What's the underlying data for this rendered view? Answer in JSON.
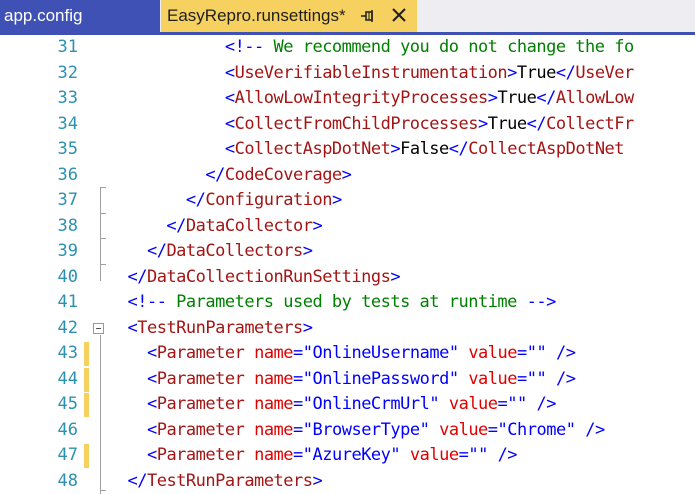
{
  "tabs": [
    {
      "label": "app.config",
      "active": false
    },
    {
      "label": "EasyRepro.runsettings*",
      "active": true,
      "pin_icon": "pin-icon",
      "close_icon": "close-icon"
    }
  ],
  "colors": {
    "tab_inactive_bg": "#3f51b5",
    "tab_active_bg": "#f7d15f",
    "line_number": "#2b91af",
    "xml_delimiter": "#0000ff",
    "xml_name": "#a31515",
    "xml_attribute": "#e00000",
    "comment": "#008000",
    "change_marker": "#f7d15f"
  },
  "editor": {
    "lines": [
      {
        "num": "31",
        "changed": false,
        "tokens": [
          [
            "c",
            "            "
          ],
          [
            "blue",
            "<!--"
          ],
          [
            "green",
            " We recommend you do not change the fo"
          ]
        ]
      },
      {
        "num": "32",
        "changed": false,
        "tokens": [
          [
            "c",
            "            "
          ],
          [
            "blue",
            "<"
          ],
          [
            "mar",
            "UseVerifiableInstrumentation"
          ],
          [
            "blue",
            ">"
          ],
          [
            "black",
            "True"
          ],
          [
            "blue",
            "</"
          ],
          [
            "mar",
            "UseVer"
          ]
        ]
      },
      {
        "num": "33",
        "changed": false,
        "tokens": [
          [
            "c",
            "            "
          ],
          [
            "blue",
            "<"
          ],
          [
            "mar",
            "AllowLowIntegrityProcesses"
          ],
          [
            "blue",
            ">"
          ],
          [
            "black",
            "True"
          ],
          [
            "blue",
            "</"
          ],
          [
            "mar",
            "AllowLow"
          ]
        ]
      },
      {
        "num": "34",
        "changed": false,
        "tokens": [
          [
            "c",
            "            "
          ],
          [
            "blue",
            "<"
          ],
          [
            "mar",
            "CollectFromChildProcesses"
          ],
          [
            "blue",
            ">"
          ],
          [
            "black",
            "True"
          ],
          [
            "blue",
            "</"
          ],
          [
            "mar",
            "CollectFr"
          ]
        ]
      },
      {
        "num": "35",
        "changed": false,
        "tokens": [
          [
            "c",
            "            "
          ],
          [
            "blue",
            "<"
          ],
          [
            "mar",
            "CollectAspDotNet"
          ],
          [
            "blue",
            ">"
          ],
          [
            "black",
            "False"
          ],
          [
            "blue",
            "</"
          ],
          [
            "mar",
            "CollectAspDotNet"
          ]
        ]
      },
      {
        "num": "36",
        "changed": false,
        "tokens": [
          [
            "c",
            "          "
          ],
          [
            "blue",
            "</"
          ],
          [
            "mar",
            "CodeCoverage"
          ],
          [
            "blue",
            ">"
          ]
        ]
      },
      {
        "num": "37",
        "changed": false,
        "tokens": [
          [
            "c",
            "        "
          ],
          [
            "blue",
            "</"
          ],
          [
            "mar",
            "Configuration"
          ],
          [
            "blue",
            ">"
          ]
        ]
      },
      {
        "num": "38",
        "changed": false,
        "tokens": [
          [
            "c",
            "      "
          ],
          [
            "blue",
            "</"
          ],
          [
            "mar",
            "DataCollector"
          ],
          [
            "blue",
            ">"
          ]
        ]
      },
      {
        "num": "39",
        "changed": false,
        "tokens": [
          [
            "c",
            "    "
          ],
          [
            "blue",
            "</"
          ],
          [
            "mar",
            "DataCollectors"
          ],
          [
            "blue",
            ">"
          ]
        ]
      },
      {
        "num": "40",
        "changed": false,
        "tokens": [
          [
            "c",
            "  "
          ],
          [
            "blue",
            "</"
          ],
          [
            "mar",
            "DataCollectionRunSettings"
          ],
          [
            "blue",
            ">"
          ]
        ]
      },
      {
        "num": "41",
        "changed": false,
        "tokens": [
          [
            "c",
            "  "
          ],
          [
            "blue",
            "<!--"
          ],
          [
            "green",
            " Parameters used by tests at runtime "
          ],
          [
            "blue",
            "-->"
          ]
        ]
      },
      {
        "num": "42",
        "changed": false,
        "fold": true,
        "tokens": [
          [
            "c",
            "  "
          ],
          [
            "blue",
            "<"
          ],
          [
            "mar",
            "TestRunParameters"
          ],
          [
            "blue",
            ">"
          ]
        ]
      },
      {
        "num": "43",
        "changed": true,
        "tokens": [
          [
            "c",
            "    "
          ],
          [
            "blue",
            "<"
          ],
          [
            "mar",
            "Parameter"
          ],
          [
            "c",
            " "
          ],
          [
            "red",
            "name"
          ],
          [
            "blue",
            "=\""
          ],
          [
            "blue",
            "OnlineUsername"
          ],
          [
            "blue",
            "\""
          ],
          [
            "c",
            " "
          ],
          [
            "red",
            "value"
          ],
          [
            "blue",
            "=\"\""
          ],
          [
            "c",
            " "
          ],
          [
            "blue",
            "/>"
          ]
        ]
      },
      {
        "num": "44",
        "changed": true,
        "tokens": [
          [
            "c",
            "    "
          ],
          [
            "blue",
            "<"
          ],
          [
            "mar",
            "Parameter"
          ],
          [
            "c",
            " "
          ],
          [
            "red",
            "name"
          ],
          [
            "blue",
            "=\""
          ],
          [
            "blue",
            "OnlinePassword"
          ],
          [
            "blue",
            "\""
          ],
          [
            "c",
            " "
          ],
          [
            "red",
            "value"
          ],
          [
            "blue",
            "=\"\""
          ],
          [
            "c",
            " "
          ],
          [
            "blue",
            "/>"
          ]
        ]
      },
      {
        "num": "45",
        "changed": true,
        "tokens": [
          [
            "c",
            "    "
          ],
          [
            "blue",
            "<"
          ],
          [
            "mar",
            "Parameter"
          ],
          [
            "c",
            " "
          ],
          [
            "red",
            "name"
          ],
          [
            "blue",
            "=\""
          ],
          [
            "blue",
            "OnlineCrmUrl"
          ],
          [
            "blue",
            "\""
          ],
          [
            "c",
            " "
          ],
          [
            "red",
            "value"
          ],
          [
            "blue",
            "=\"\""
          ],
          [
            "c",
            " "
          ],
          [
            "blue",
            "/>"
          ]
        ]
      },
      {
        "num": "46",
        "changed": false,
        "tokens": [
          [
            "c",
            "    "
          ],
          [
            "blue",
            "<"
          ],
          [
            "mar",
            "Parameter"
          ],
          [
            "c",
            " "
          ],
          [
            "red",
            "name"
          ],
          [
            "blue",
            "=\""
          ],
          [
            "blue",
            "BrowserType"
          ],
          [
            "blue",
            "\""
          ],
          [
            "c",
            " "
          ],
          [
            "red",
            "value"
          ],
          [
            "blue",
            "=\""
          ],
          [
            "blue",
            "Chrome"
          ],
          [
            "blue",
            "\""
          ],
          [
            "c",
            " "
          ],
          [
            "blue",
            "/>"
          ]
        ]
      },
      {
        "num": "47",
        "changed": true,
        "tokens": [
          [
            "c",
            "    "
          ],
          [
            "blue",
            "<"
          ],
          [
            "mar",
            "Parameter"
          ],
          [
            "c",
            " "
          ],
          [
            "red",
            "name"
          ],
          [
            "blue",
            "=\""
          ],
          [
            "blue",
            "AzureKey"
          ],
          [
            "blue",
            "\""
          ],
          [
            "c",
            " "
          ],
          [
            "red",
            "value"
          ],
          [
            "blue",
            "=\"\""
          ],
          [
            "c",
            " "
          ],
          [
            "blue",
            "/>"
          ]
        ]
      },
      {
        "num": "48",
        "changed": false,
        "tokens": [
          [
            "c",
            "  "
          ],
          [
            "blue",
            "</"
          ],
          [
            "mar",
            "TestRunParameters"
          ],
          [
            "blue",
            ">"
          ]
        ]
      }
    ]
  }
}
